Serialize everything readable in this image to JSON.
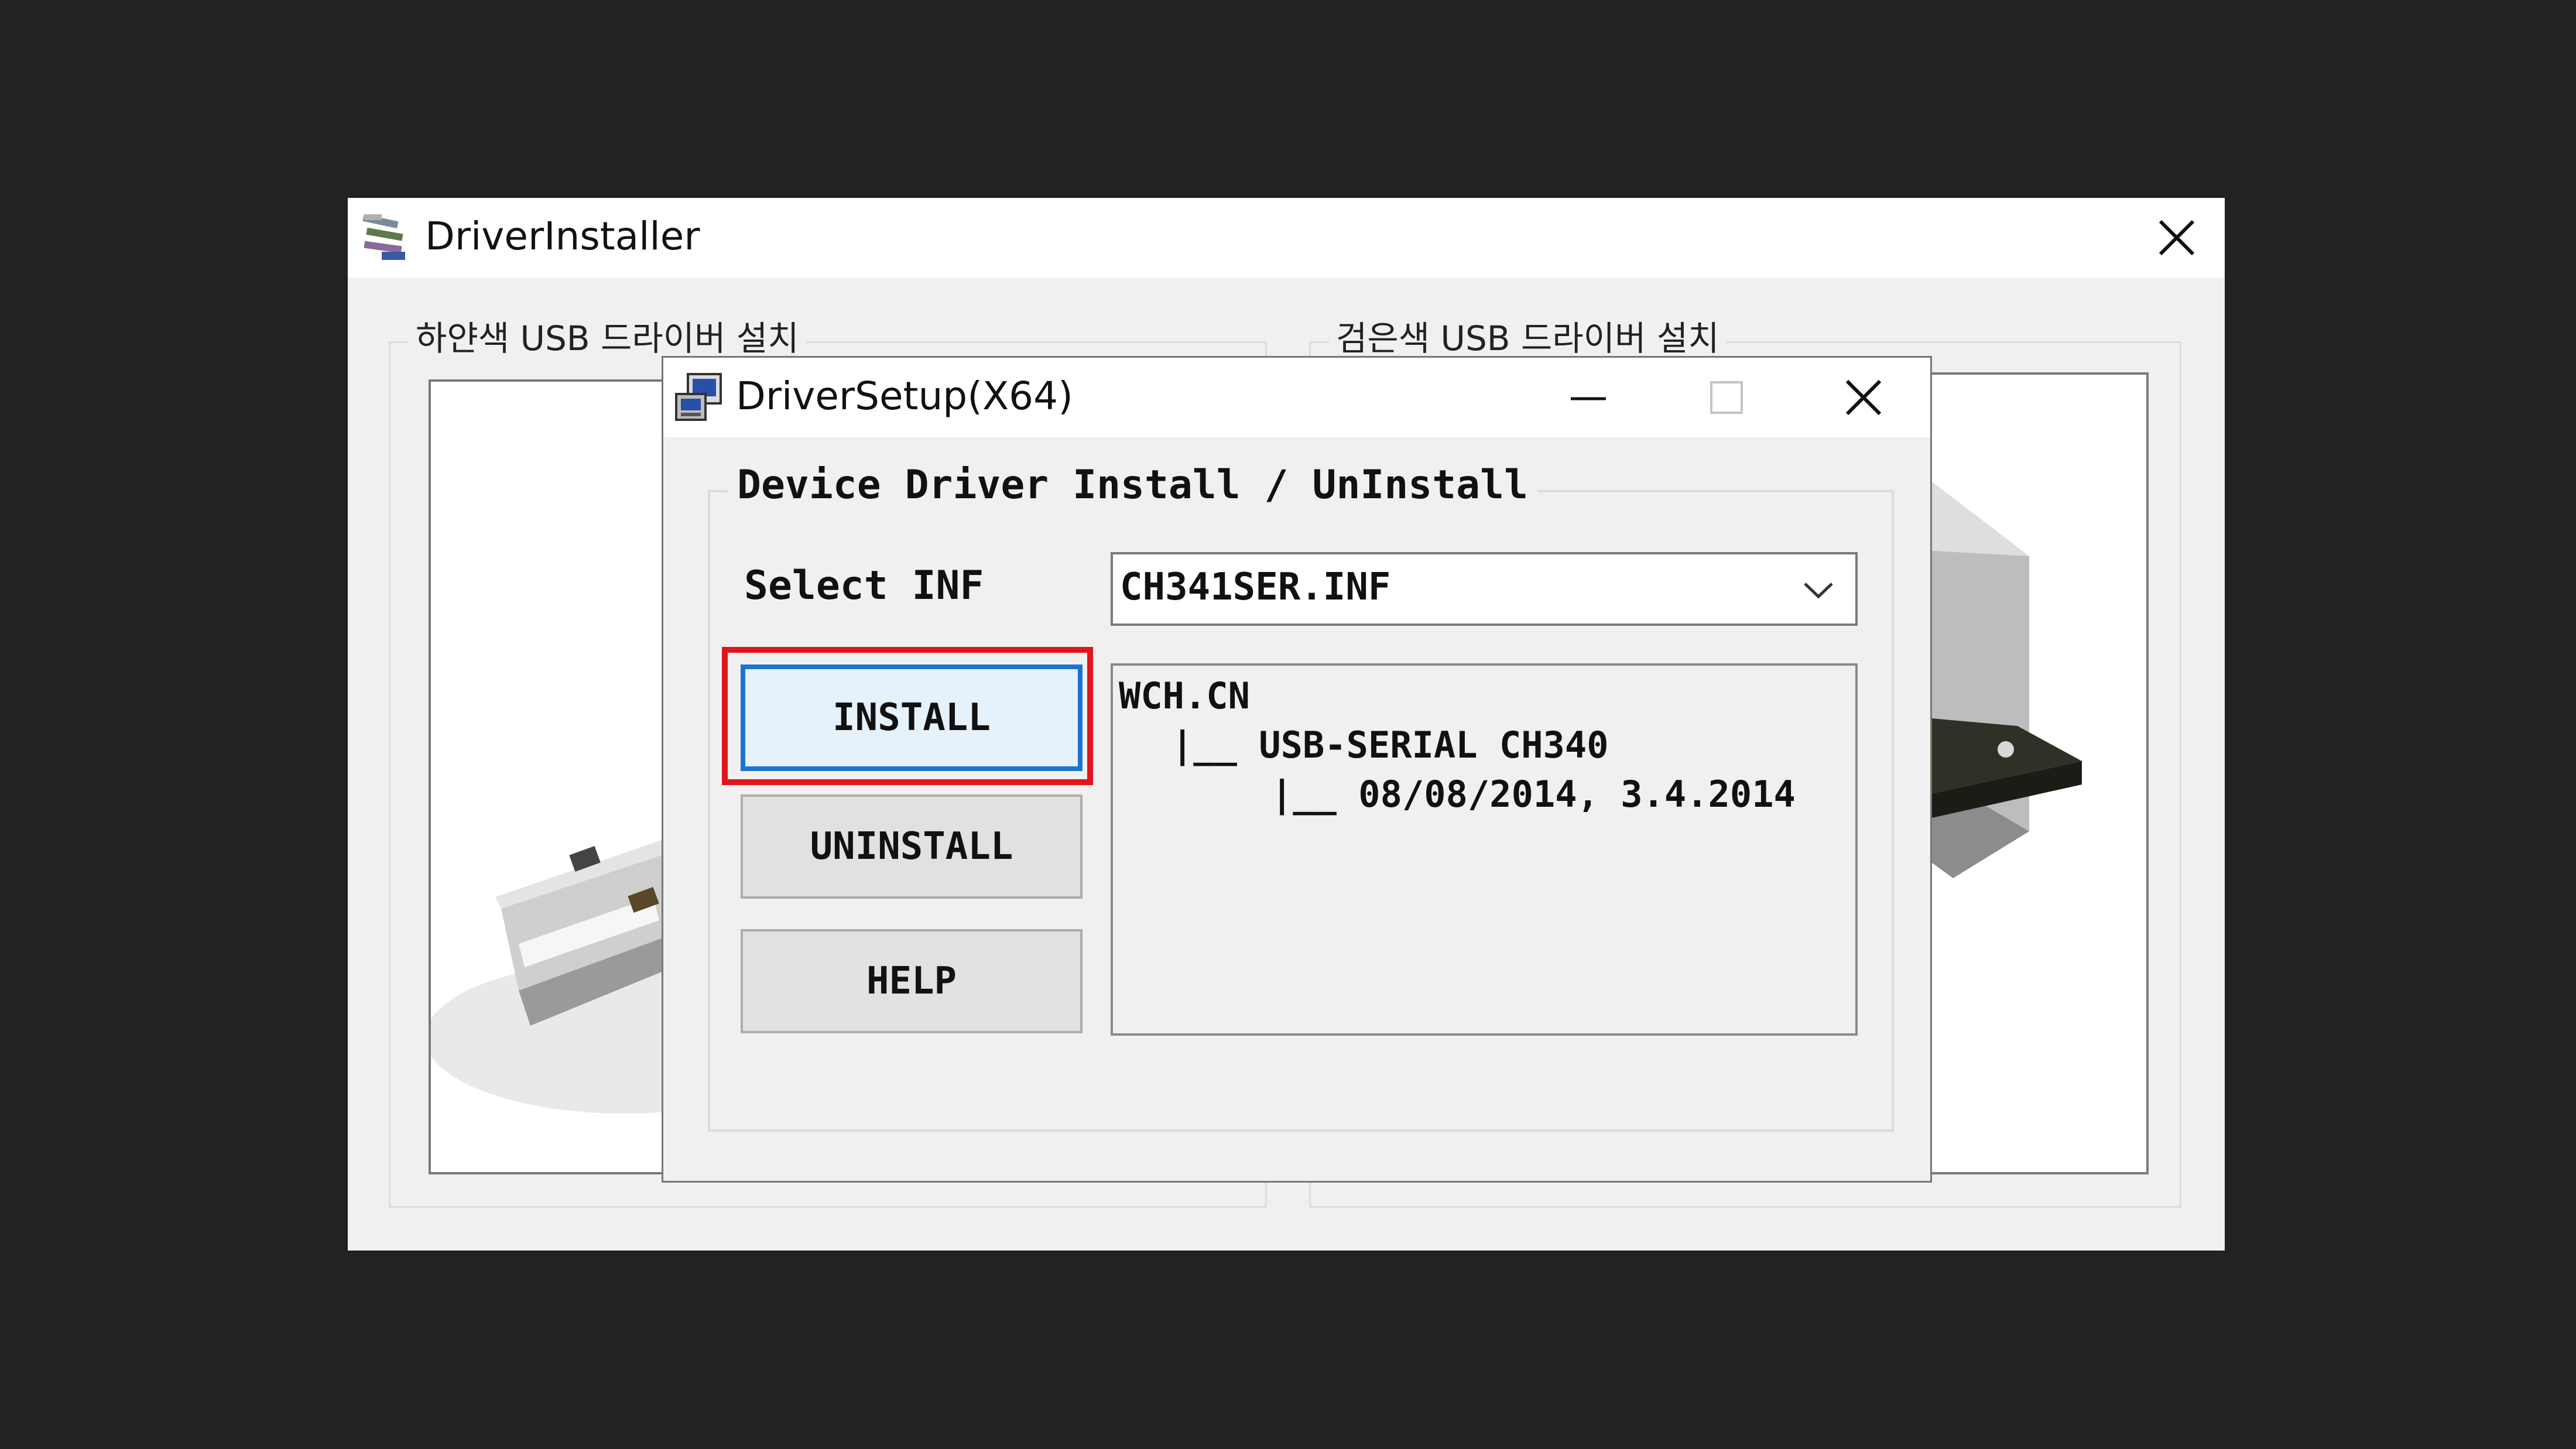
{
  "outer_window": {
    "title": "DriverInstaller",
    "icon": "driver-installer-app-icon",
    "left_group_label": "하얀색 USB 드라이버 설치",
    "right_group_label": "검은색 USB 드라이버 설치"
  },
  "dialog": {
    "title": "DriverSetup(X64)",
    "icon": "driver-setup-app-icon",
    "group_label": "Device Driver Install / UnInstall",
    "select_label": "Select INF",
    "select_value": "CH341SER.INF",
    "buttons": {
      "install": "INSTALL",
      "uninstall": "UNINSTALL",
      "help": "HELP"
    },
    "info_lines": [
      "WCH.CN",
      "|__ USB-SERIAL CH340",
      "|__ 08/08/2014, 3.4.2014"
    ]
  },
  "colors": {
    "highlight": "#e2141c",
    "focus_border": "#1c74d0",
    "backdrop": "#222222"
  }
}
